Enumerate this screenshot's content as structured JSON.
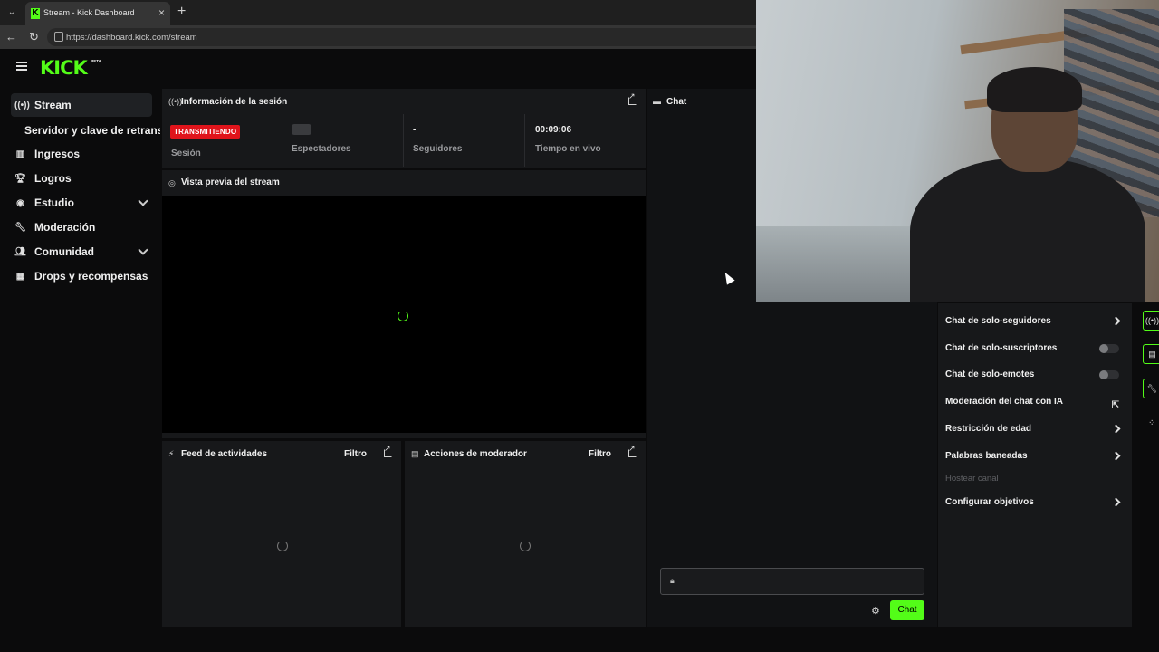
{
  "browser": {
    "tab_title": "Stream - Kick Dashboard",
    "url": "https://dashboard.kick.com/stream"
  },
  "header": {
    "logo": "KICK",
    "logo_badge": "BETA"
  },
  "sidebar": {
    "items": [
      {
        "label": "Stream",
        "icon": "broadcast-icon",
        "active": true
      },
      {
        "label": "Ingresos",
        "icon": "chart-icon"
      },
      {
        "label": "Logros",
        "icon": "trophy-icon"
      },
      {
        "label": "Estudio",
        "icon": "palette-icon",
        "expandable": true
      },
      {
        "label": "Moderación",
        "icon": "wrench-icon"
      },
      {
        "label": "Comunidad",
        "icon": "users-icon",
        "expandable": true
      },
      {
        "label": "Drops y recompensas",
        "icon": "gift-icon"
      }
    ],
    "sub_item": "Servidor y clave de retransmisión"
  },
  "session": {
    "title": "Información de la sesión",
    "badge": "TRANSMITIENDO",
    "stats": [
      {
        "label": "Sesión",
        "value": ""
      },
      {
        "label": "Espectadores",
        "value": ""
      },
      {
        "label": "Seguidores",
        "value": "-"
      },
      {
        "label": "Tiempo en vivo",
        "value": "00:09:06"
      }
    ]
  },
  "preview": {
    "title": "Vista previa del stream"
  },
  "activity": {
    "title": "Feed de actividades",
    "filter": "Filtro"
  },
  "modactions": {
    "title": "Acciones de moderador",
    "filter": "Filtro"
  },
  "chat": {
    "title": "Chat",
    "send_label": "Chat"
  },
  "settings": {
    "items": [
      {
        "label": "Chat de solo-seguidores",
        "control": "chevron"
      },
      {
        "label": "Chat de solo-suscriptores",
        "control": "toggle"
      },
      {
        "label": "Chat de solo-emotes",
        "control": "toggle"
      },
      {
        "label": "Moderación del chat con IA",
        "control": "external"
      },
      {
        "label": "Restricción de edad",
        "control": "chevron"
      },
      {
        "label": "Palabras baneadas",
        "control": "chevron"
      },
      {
        "label": "Hostear canal",
        "control": "none",
        "disabled": true
      },
      {
        "label": "Configurar objetivos",
        "control": "chevron"
      }
    ]
  },
  "colors": {
    "brand": "#53fc18",
    "live": "#e0141b",
    "panel": "#17181a"
  }
}
